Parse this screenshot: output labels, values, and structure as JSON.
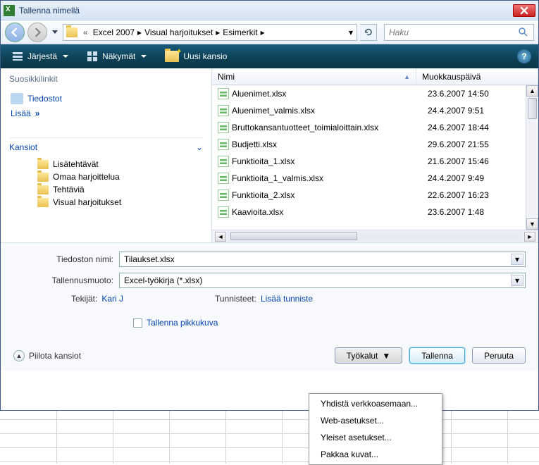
{
  "title": "Tallenna nimellä",
  "breadcrumb": [
    "Excel 2007",
    "Visual harjoitukset",
    "Esimerkit"
  ],
  "search_placeholder": "Haku",
  "toolbar": {
    "organize": "Järjestä",
    "views": "Näkymät",
    "newfolder": "Uusi kansio"
  },
  "left": {
    "favheader": "Suosikkilinkit",
    "documents": "Tiedostot",
    "more": "Lisää",
    "folders_head": "Kansiot",
    "tree": [
      "Lisätehtävät",
      "Omaa harjoittelua",
      "Tehtäviä",
      "Visual harjoitukset"
    ]
  },
  "columns": {
    "name": "Nimi",
    "date": "Muokkauspäivä"
  },
  "files": [
    {
      "name": "Aluenimet.xlsx",
      "date": "23.6.2007 14:50"
    },
    {
      "name": "Aluenimet_valmis.xlsx",
      "date": "24.4.2007 9:51"
    },
    {
      "name": "Bruttokansantuotteet_toimialoittain.xlsx",
      "date": "24.6.2007 18:44"
    },
    {
      "name": "Budjetti.xlsx",
      "date": "29.6.2007 21:55"
    },
    {
      "name": "Funktioita_1.xlsx",
      "date": "21.6.2007 15:46"
    },
    {
      "name": "Funktioita_1_valmis.xlsx",
      "date": "24.4.2007 9:49"
    },
    {
      "name": "Funktioita_2.xlsx",
      "date": "22.6.2007 16:23"
    },
    {
      "name": "Kaavioita.xlsx",
      "date": "23.6.2007 1:48"
    }
  ],
  "form": {
    "filename_label": "Tiedoston nimi:",
    "filename_value": "Tilaukset.xlsx",
    "filetype_label": "Tallennusmuoto:",
    "filetype_value": "Excel-työkirja (*.xlsx)",
    "authors_label": "Tekijät:",
    "authors_value": "Kari J",
    "tags_label": "Tunnisteet:",
    "tags_value": "Lisää tunniste",
    "thumbnail": "Tallenna pikkukuva"
  },
  "buttons": {
    "hide_folders": "Piilota kansiot",
    "tools": "Työkalut",
    "save": "Tallenna",
    "cancel": "Peruuta"
  },
  "tools_menu": [
    "Yhdistä verkkoasemaan...",
    "Web-asetukset...",
    "Yleiset asetukset...",
    "Pakkaa kuvat..."
  ]
}
